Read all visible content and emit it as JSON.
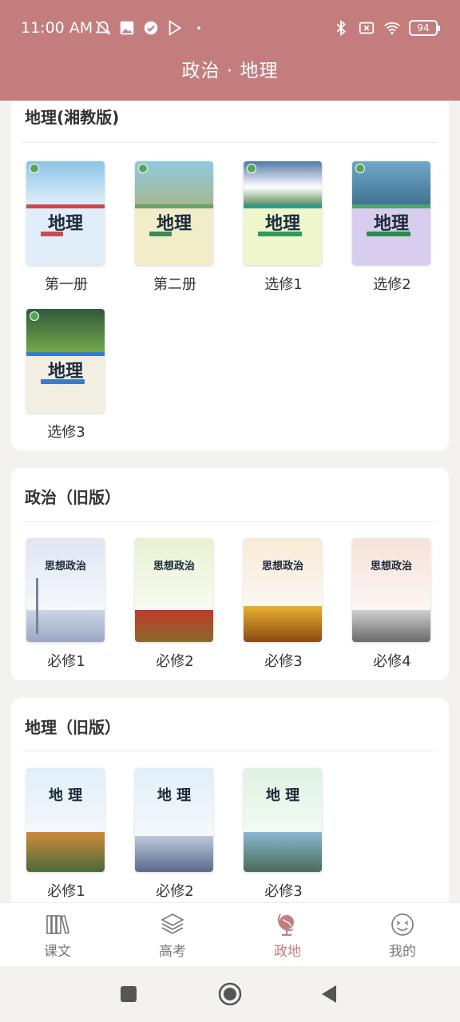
{
  "status": {
    "time": "11:00 AM",
    "battery": "94"
  },
  "header": {
    "title": "政治 · 地理"
  },
  "sections": [
    {
      "title": "地理(湘教版)",
      "books": [
        {
          "label": "第一册",
          "cover_title": "地理"
        },
        {
          "label": "第二册",
          "cover_title": "地理"
        },
        {
          "label": "选修1",
          "cover_title": "地理"
        },
        {
          "label": "选修2",
          "cover_title": "地理"
        },
        {
          "label": "选修3",
          "cover_title": "地理"
        }
      ]
    },
    {
      "title": "政治（旧版）",
      "books": [
        {
          "label": "必修1",
          "cover_title": "思想政治"
        },
        {
          "label": "必修2",
          "cover_title": "思想政治"
        },
        {
          "label": "必修3",
          "cover_title": "思想政治"
        },
        {
          "label": "必修4",
          "cover_title": "思想政治"
        }
      ]
    },
    {
      "title": "地理（旧版）",
      "books": [
        {
          "label": "必修1",
          "cover_title": "地 理"
        },
        {
          "label": "必修2",
          "cover_title": "地 理"
        },
        {
          "label": "必修3",
          "cover_title": "地 理"
        }
      ]
    }
  ],
  "tabs": [
    {
      "label": "课文",
      "icon": "books-icon"
    },
    {
      "label": "高考",
      "icon": "layers-icon"
    },
    {
      "label": "政地",
      "icon": "globe-icon",
      "active": true
    },
    {
      "label": "我的",
      "icon": "smiley-icon"
    }
  ],
  "colors": {
    "accent": "#c37d7d",
    "tab_inactive": "#777777"
  }
}
